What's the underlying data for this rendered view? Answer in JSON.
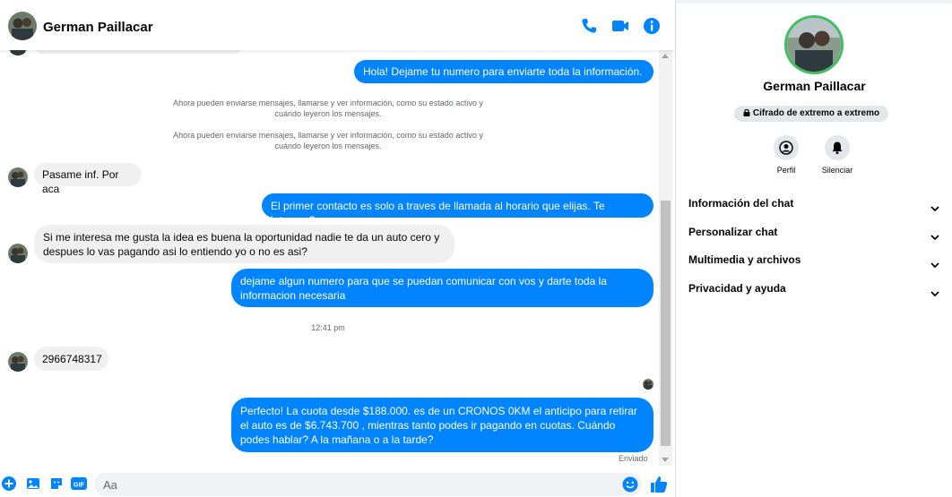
{
  "colors": {
    "messenger_blue": "#0084ff",
    "incoming_bg": "#f0f0f0",
    "active_ring": "#3fbf5f"
  },
  "header": {
    "contact_name": "German Paillacar",
    "icons": [
      "phone-icon",
      "video-camera-icon",
      "info-icon"
    ]
  },
  "messages": [
    {
      "id": "m1",
      "direction": "out",
      "text": "Hola! Dejame tu numero  para enviarte toda la información."
    },
    {
      "id": "s1",
      "direction": "system",
      "text": "Ahora pueden enviarse mensajes, llamarse y ver información, como su estado activo y cuándo leyeron los mensajes."
    },
    {
      "id": "s2",
      "direction": "system",
      "text": "Ahora pueden enviarse mensajes, llamarse y ver información, como su estado activo y cuándo leyeron los mensajes."
    },
    {
      "id": "m2",
      "direction": "in",
      "text": "Pasame inf. Por aca"
    },
    {
      "id": "m3",
      "direction": "out",
      "text": "El primer contacto es solo a traves de llamada al horario que elijas. Te interesa?"
    },
    {
      "id": "m4",
      "direction": "in",
      "text": "Si me interesa me gusta la idea es buena la oportunidad nadie te da un auto cero y despues lo vas pagando asi lo entiendo yo o no es asi?"
    },
    {
      "id": "m5",
      "direction": "out",
      "text": "dejame algun numero para que se puedan comunicar con vos y darte toda la informacion necesaria"
    },
    {
      "id": "t1",
      "direction": "time",
      "text": "12:41 pm"
    },
    {
      "id": "m6",
      "direction": "in",
      "text": "2966748317"
    },
    {
      "id": "m7",
      "direction": "out",
      "text": "Perfecto! La cuota desde $188.000. es de un CRONOS 0KM el anticipo para retirar el auto es de $6.743.700 , mientras tanto podes ir pagando en cuotas. Cuándo podes hablar? A la mañana o a la tarde?"
    }
  ],
  "status": {
    "sent_label": "Enviado"
  },
  "composer": {
    "placeholder": "Aa",
    "icons": [
      "plus-icon",
      "image-icon",
      "sticker-icon",
      "gif-icon",
      "emoji-icon",
      "like-icon"
    ],
    "gif_label": "GIF"
  },
  "side_panel": {
    "contact_name": "German Paillacar",
    "encryption_label": "Cifrado de extremo a extremo",
    "actions": [
      {
        "label": "Perfil",
        "icon": "profile-icon"
      },
      {
        "label": "Silenciar",
        "icon": "bell-icon"
      }
    ],
    "sections": [
      {
        "label": "Información del chat"
      },
      {
        "label": "Personalizar chat"
      },
      {
        "label": "Multimedia y archivos"
      },
      {
        "label": "Privacidad y ayuda"
      }
    ]
  }
}
